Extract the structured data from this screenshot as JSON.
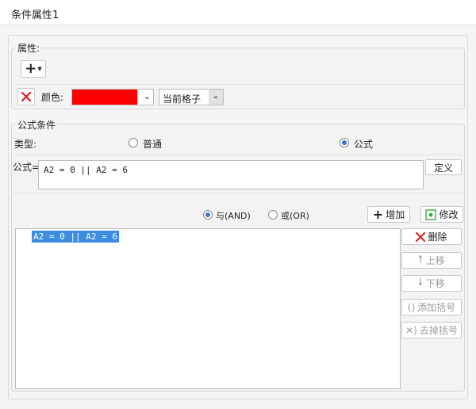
{
  "window": {
    "title": "条件属性1"
  },
  "properties": {
    "section_label": "属性:",
    "add_icon": "plus-icon",
    "color_label": "颜色:",
    "color_value": "#ff0000",
    "scope_value": "当前格子"
  },
  "formula_section": {
    "section_label": "公式条件",
    "type_label": "类型:",
    "option_normal": "普通",
    "option_formula": "公式",
    "selected": "公式",
    "formula_label": "公式=",
    "formula_value": "A2 = 0 || A2 = 6",
    "define_button": "定义"
  },
  "conditions": {
    "and_label": "与(AND)",
    "or_label": "或(OR)",
    "logic_selected": "与(AND)",
    "add_button": "增加",
    "modify_button": "修改",
    "items": [
      "A2 = 0 || A2 = 6"
    ],
    "delete_button": "删除",
    "up_button": "上移",
    "down_button": "下移",
    "add_bracket_button": "添加括号",
    "remove_bracket_button": "去掉括号"
  },
  "colors": {
    "accent": "#3c8de0",
    "delete_red": "#e02020",
    "modify_green": "#3aa845"
  }
}
